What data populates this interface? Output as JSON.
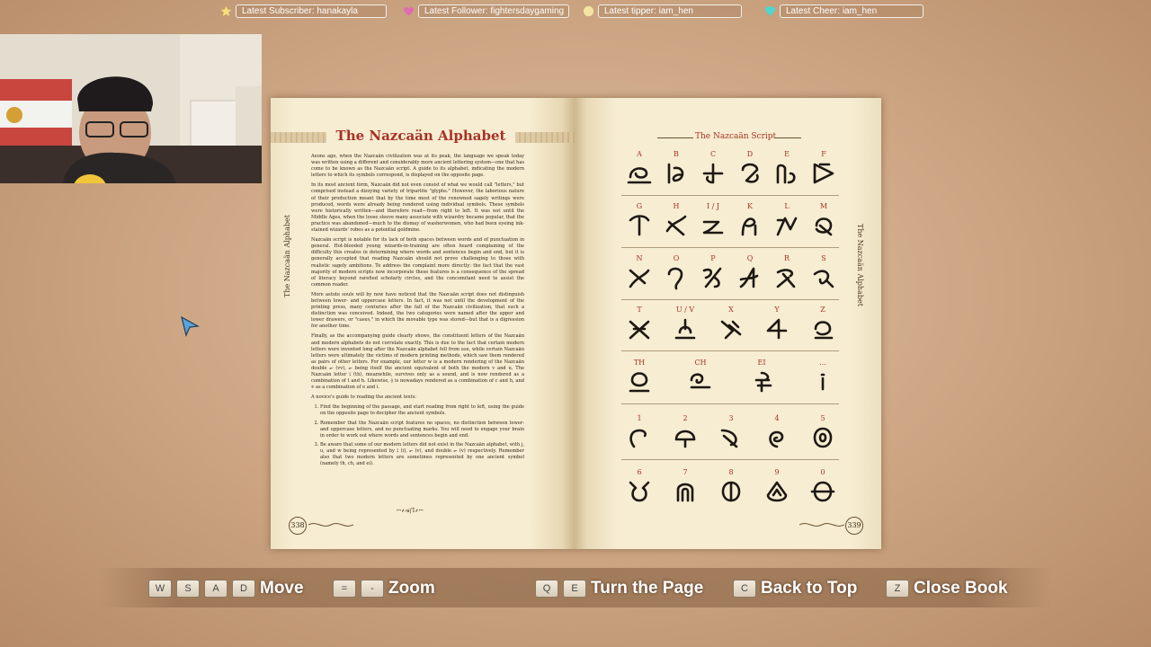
{
  "topbar": {
    "items": [
      {
        "label": "Latest Subscriber: hanakayla",
        "icon": "star-icon",
        "color": "#f7e07a"
      },
      {
        "label": "Latest Follower: fightersdaygaming",
        "icon": "heart-icon",
        "color": "#e06bb0"
      },
      {
        "label": "Latest tipper: iam_hen",
        "icon": "coin-icon",
        "color": "#f5e3a3"
      },
      {
        "label": "Latest Cheer: iam_hen",
        "icon": "gem-icon",
        "color": "#4fd6d0"
      }
    ]
  },
  "book": {
    "left_page": {
      "title": "The Nazcaän Alphabet",
      "side_label": "The Nazcaän Alphabet",
      "page_number": "338",
      "paragraphs": [
        "Aeons ago, when the Nazcaän civilization was at its peak, the language we speak today was written using a different and considerably more ancient lettering system—one that has come to be known as the Nazcaän script. A guide to its alphabet, indicating the modern letters to which its symbols correspond, is displayed on the opposite page.",
        "In its most ancient form, Nazcaän did not even consist of what we would call \"letters,\" but comprised instead a dizzying variety of tripartite \"glyphs.\" However, the laborious nature of their production meant that by the time most of the renowned sagely writings were produced, words were already being rendered using individual symbols. These symbols were historically written—and therefore read—from right to left. It was not until the Middle Ages, when the loose sleeve many associate with wizardry became popular, that the practice was abandoned—much to the dismay of washerwomen, who had been eyeing ink-stained wizards' robes as a potential goldmine.",
        "Nazcaän script is notable for its lack of both spaces between words and of punctuation in general. Hot-blooded young wizards-in-training are often heard complaining of the difficulty this creates in determining where words and sentences begin and end, but it is generally accepted that reading Nazcaän should not prove challenging to those with realistic sagely ambitions. To address the complaint more directly: the fact that the vast majority of modern scripts now incorporate these features is a consequence of the spread of literacy beyond rarefied scholarly circles, and the concomitant need to assist the common reader.",
        "More astute souls will by now have noticed that the Nazcaän script does not distinguish between lower- and uppercase letters. In fact, it was not until the development of the printing press, many centuries after the fall of the Nazcaän civilization, that such a distinction was conceived. Indeed, the two categories were named after the upper and lower drawers, or \"cases,\" in which the movable type was stored—but that is a digression for another time.",
        "Finally, as the accompanying guide clearly shows, the constituent letters of the Nazcaän and modern alphabets do not correlate exactly. This is due to the fact that certain modern letters were invented long after the Nazcaän alphabet fell from use, while certain Nazcaän letters were ultimately the victims of modern printing methods, which saw them rendered as pairs of other letters. For example, our letter w is a modern rendering of the Nazcaän double ⟜ (vv), ⟜ being itself the ancient equivalent of both the modern v and u. The Nazcaän letter ⟟ (th), meanwhile, survives only as a sound, and is now rendered as a combination of t and h. Likewise, ⟠ is nowadays rendered as a combination of c and h, and ⟡ as a combination of e and i.",
        "A novice's guide to reading the ancient texts:"
      ],
      "steps": [
        "Find the beginning of the passage, and start reading from right to left, using the guide on the opposite page to decipher the ancient symbols.",
        "Remember that the Nazcaän script features no spaces, no distinction between lower- and uppercase letters, and no punctuating marks. You will need to engage your brain in order to work out where words and sentences begin and end.",
        "Be aware that some of our modern letters did not exist in the Nazcaän alphabet, with j, u, and w being represented by ⟟ (i), ⟜ (v), and double ⟜ (v) respectively. Remember also that two modern letters are sometimes represented by one ancient symbol (namely th, ch, and ei)."
      ],
      "glyph_line": "ꟷ⸙⸗ꞩꞁꞀ⸙ꟷ"
    },
    "right_page": {
      "title": "The Nazcaän Script",
      "side_label": "The Nazcaän Alphabet",
      "page_number": "339",
      "rows": [
        [
          "A",
          "B",
          "C",
          "D",
          "E",
          "F"
        ],
        [
          "G",
          "H",
          "I / J",
          "K",
          "L",
          "M"
        ],
        [
          "N",
          "O",
          "P",
          "Q",
          "R",
          "S"
        ],
        [
          "T",
          "U / V",
          "X",
          "Y",
          "Z"
        ],
        [
          "TH",
          "CH",
          "EI",
          "..."
        ],
        [
          "1",
          "2",
          "3",
          "4",
          "5"
        ],
        [
          "6",
          "7",
          "8",
          "9",
          "0"
        ]
      ]
    }
  },
  "controls": [
    {
      "keys": [
        "W",
        "S",
        "A",
        "D"
      ],
      "label": "Move"
    },
    {
      "keys": [
        "=",
        "-"
      ],
      "label": "Zoom"
    },
    {
      "keys": [
        "Q",
        "E"
      ],
      "label": "Turn the Page"
    },
    {
      "keys": [
        "C"
      ],
      "label": "Back to Top"
    },
    {
      "keys": [
        "Z"
      ],
      "label": "Close Book"
    }
  ],
  "colors": {
    "accent_red": "#a83225",
    "page": "#f6edd3",
    "background": "#cfa987"
  }
}
